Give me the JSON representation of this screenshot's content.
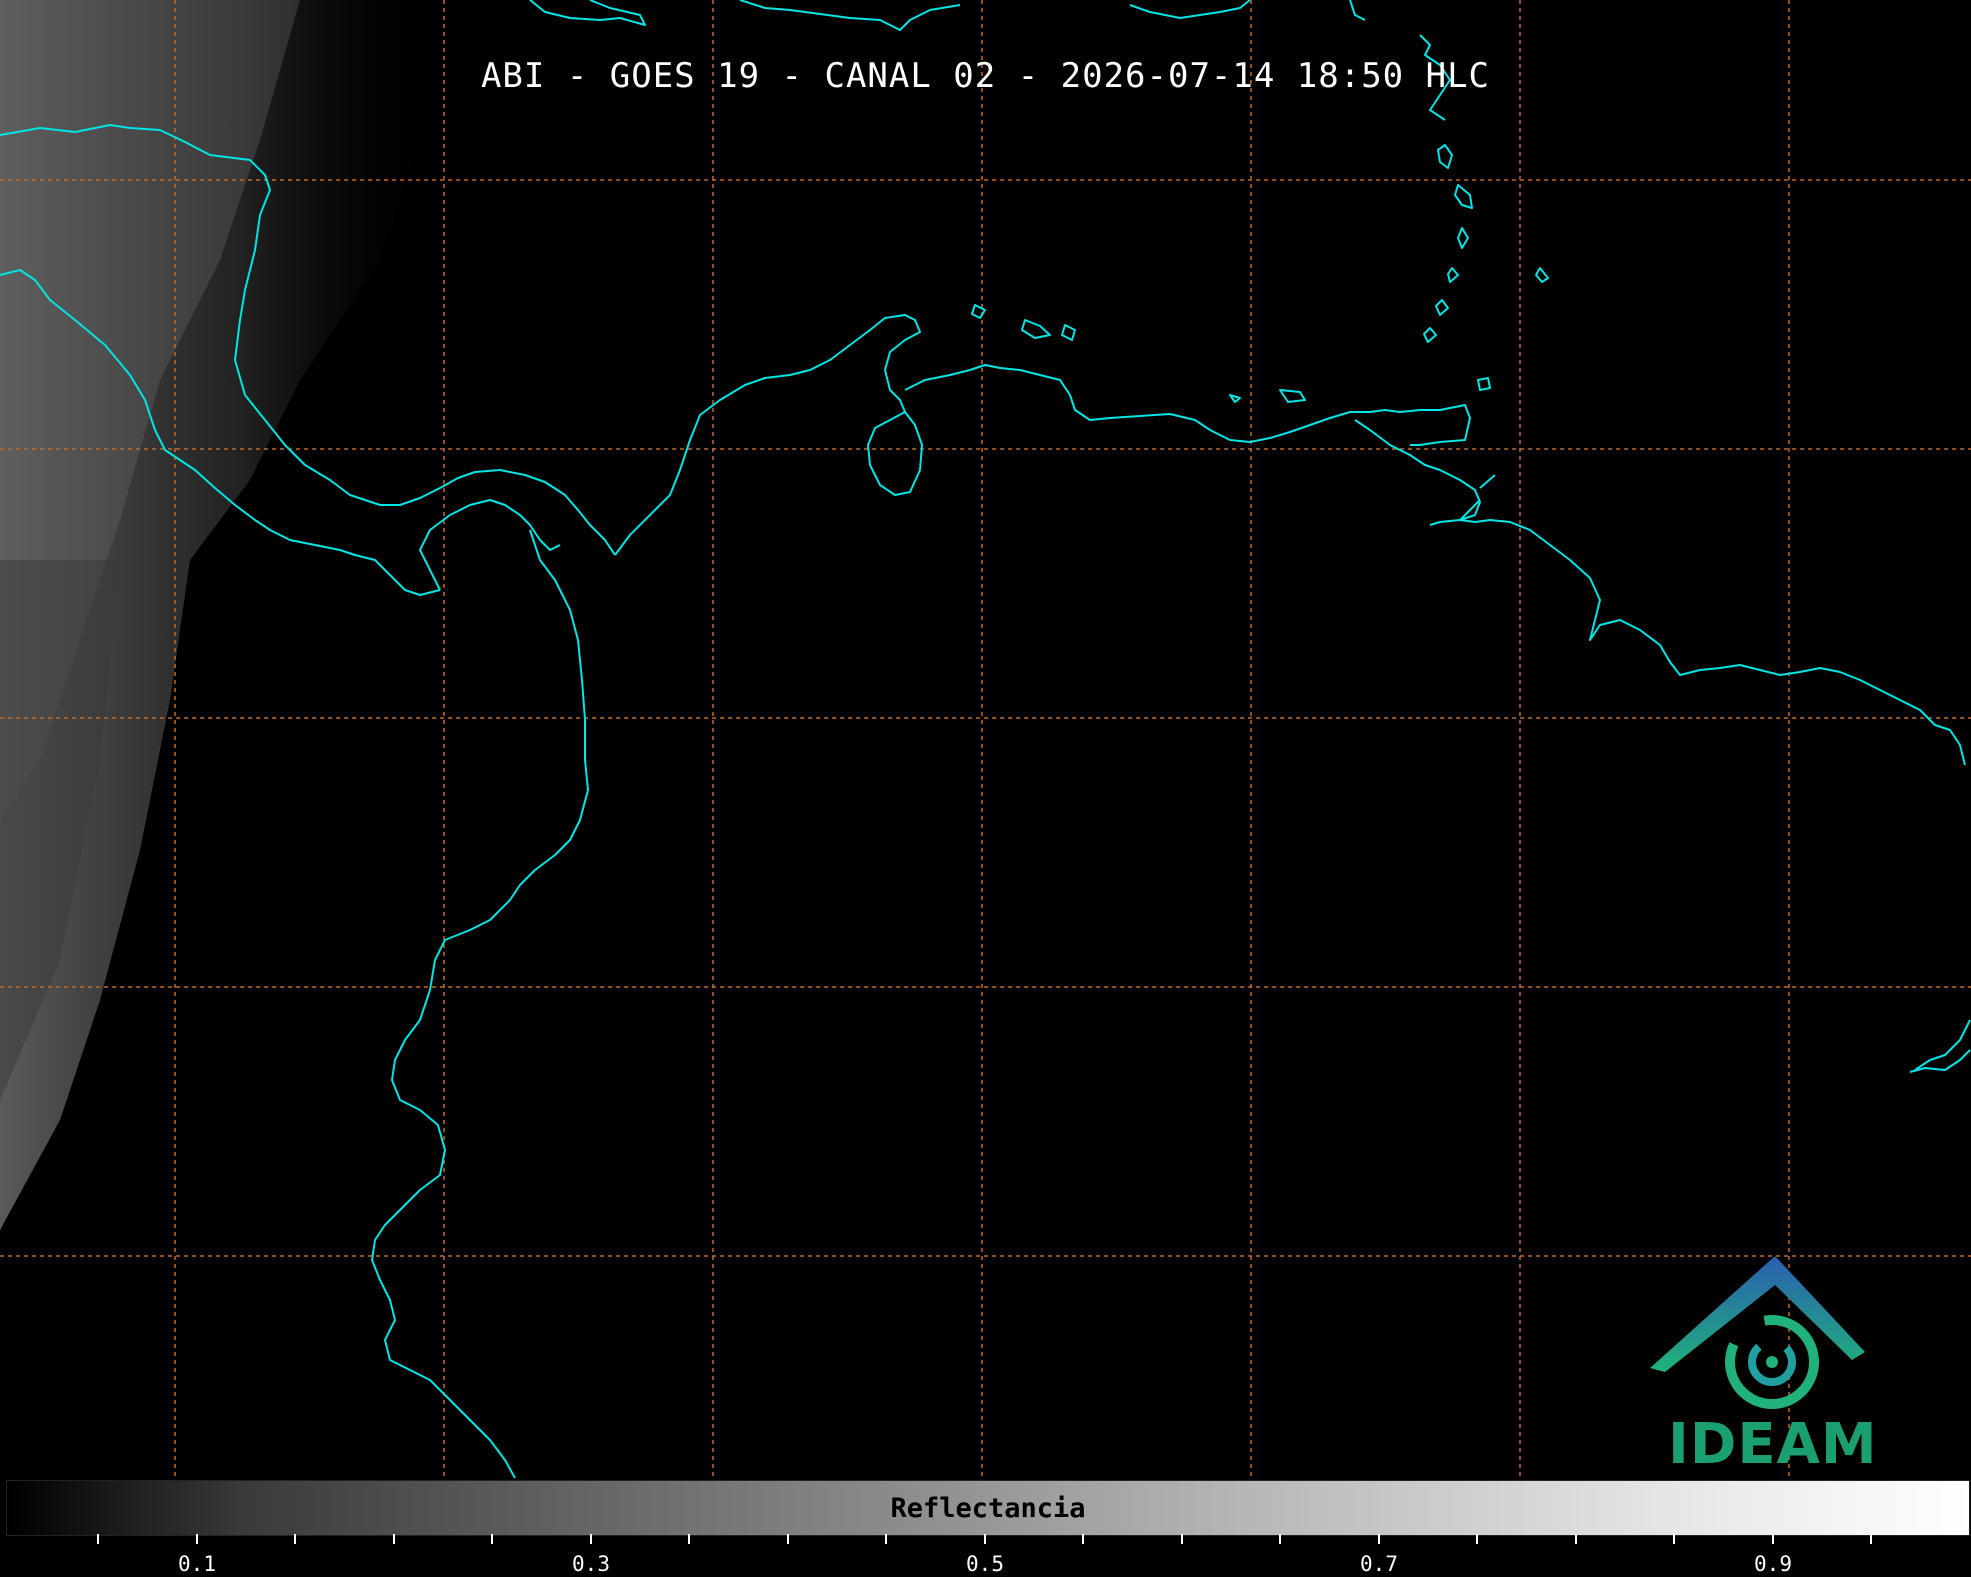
{
  "title": "ABI - GOES 19 - CANAL 02 - 2026-07-14 18:50 HLC",
  "colorbar": {
    "label": "Reflectancia",
    "ticks": [
      "0.1",
      "0.3",
      "0.5",
      "0.7",
      "0.9"
    ]
  },
  "logo": {
    "text": "IDEAM"
  },
  "colors": {
    "coastline": "#00e5e5",
    "grid": "#c06a2a",
    "background": "#000000"
  }
}
